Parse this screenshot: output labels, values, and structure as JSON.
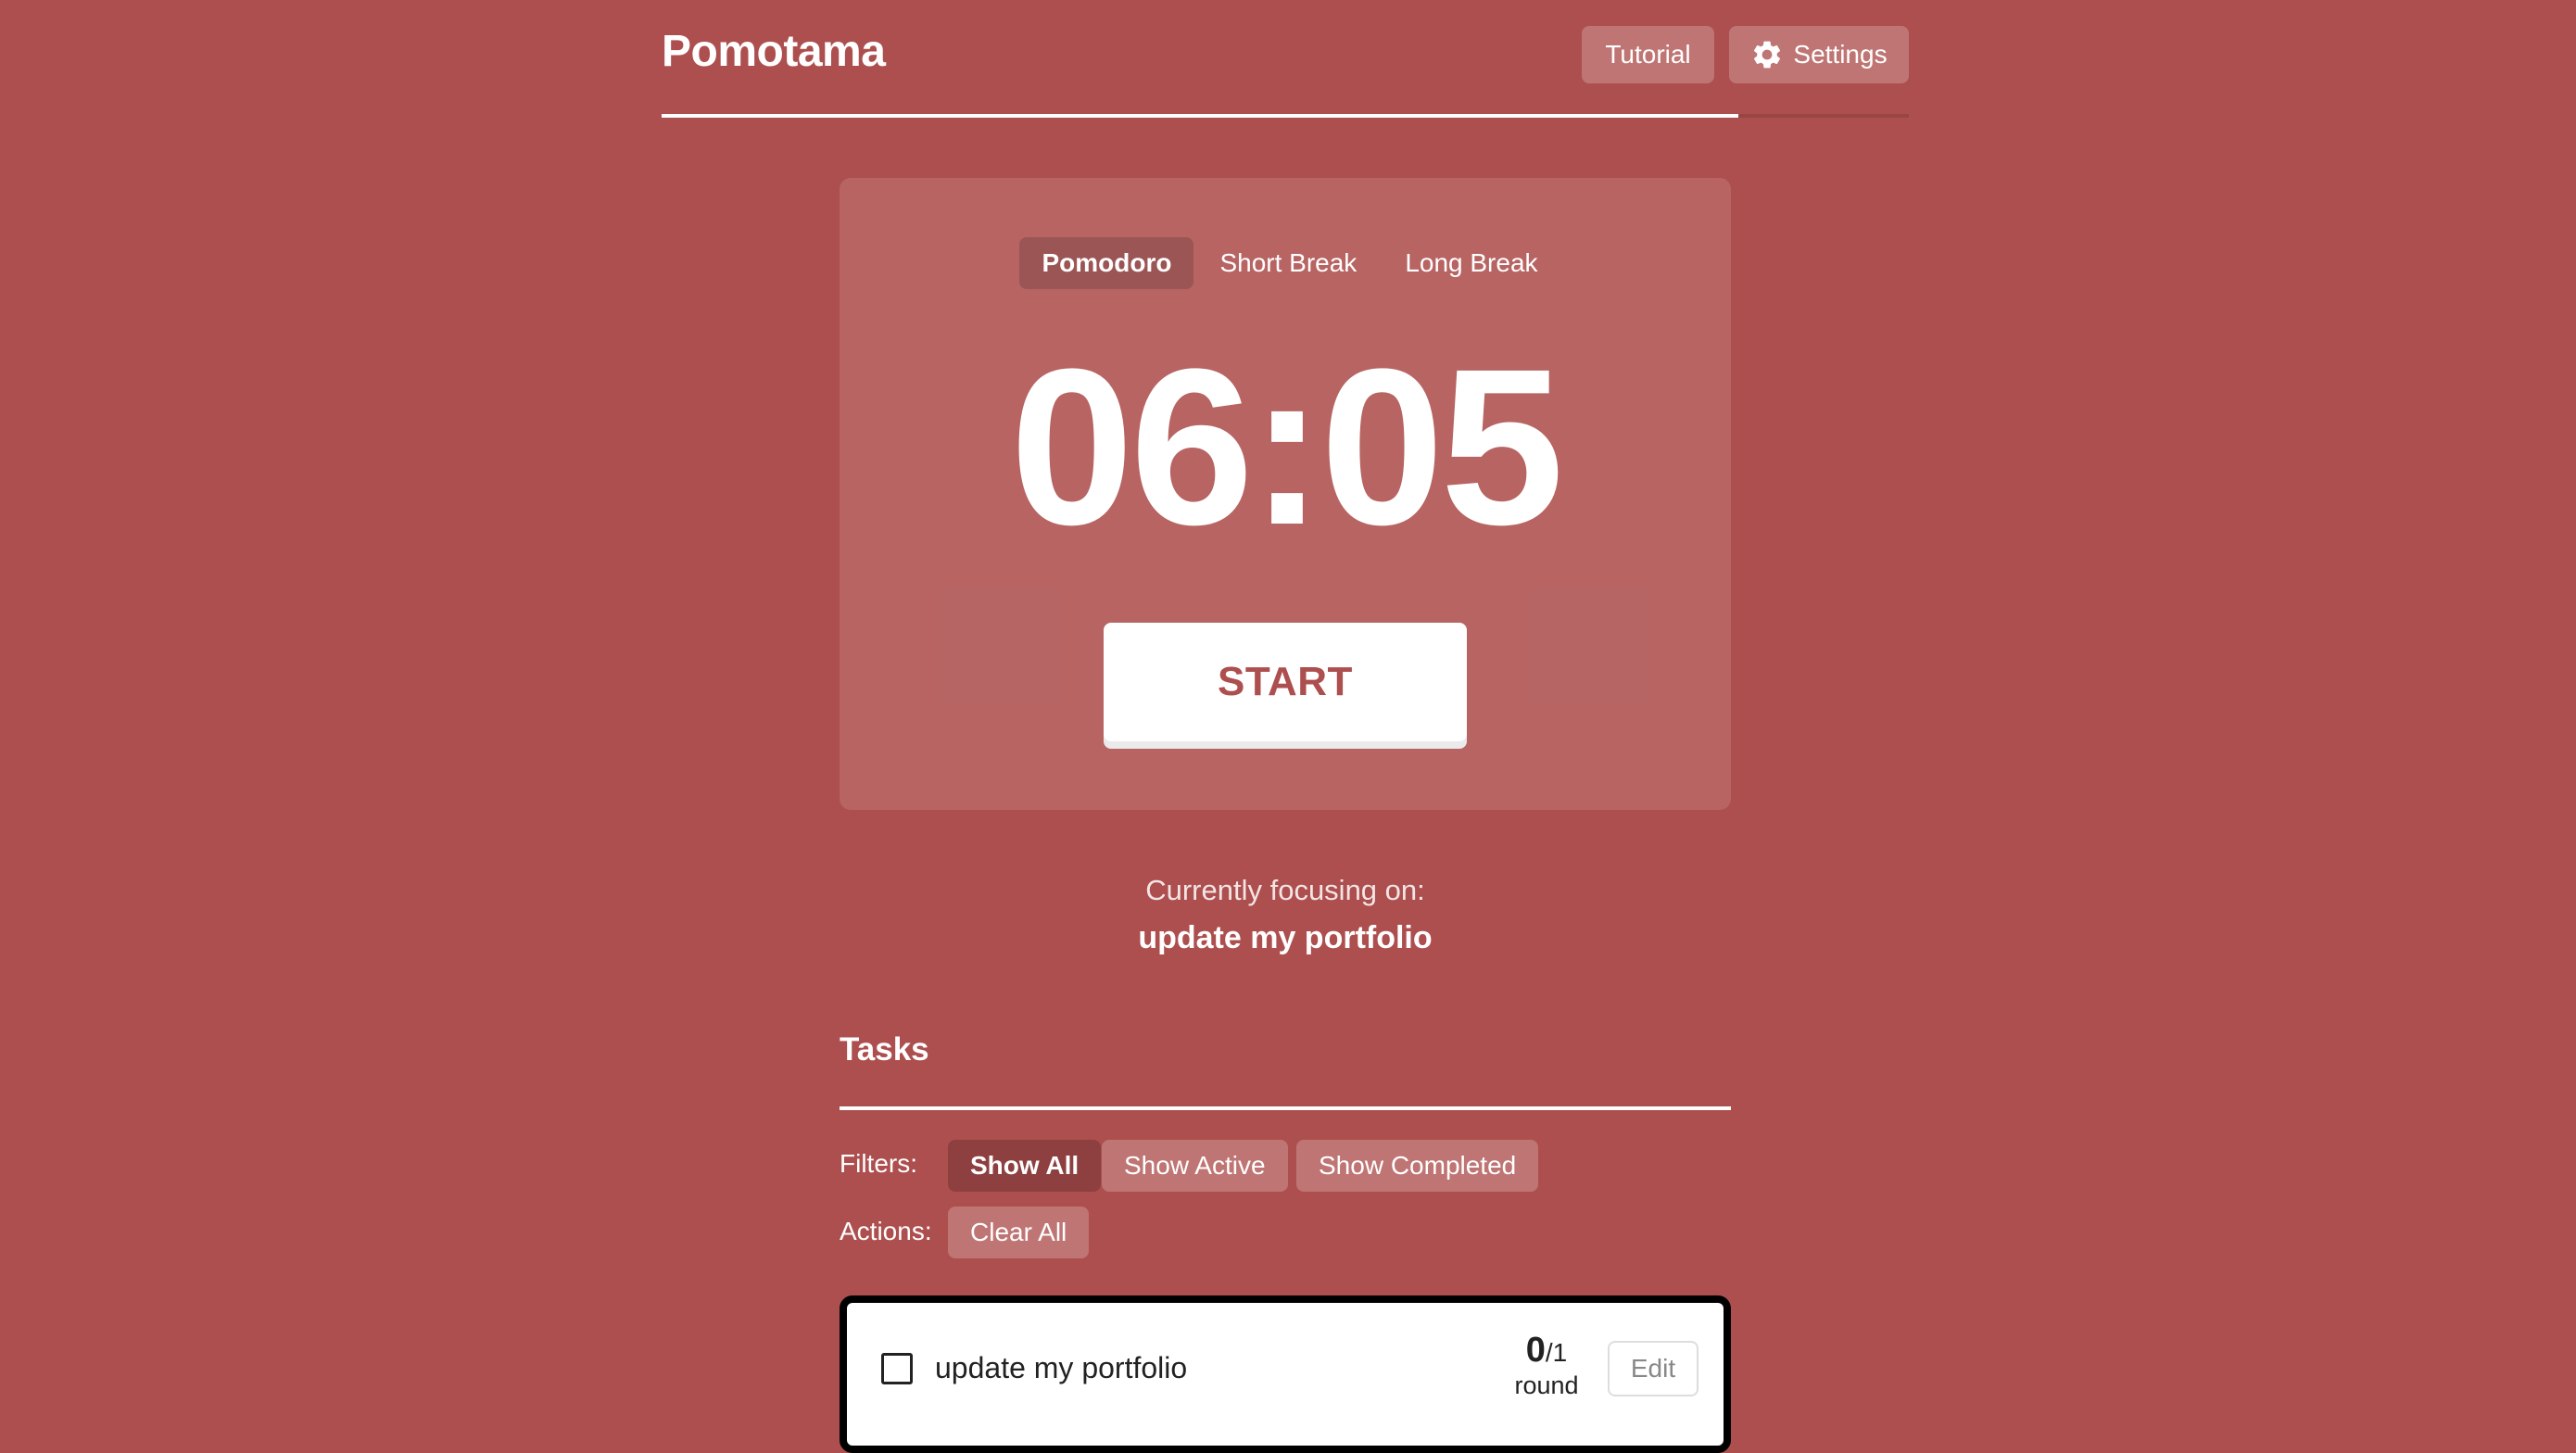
{
  "colors": {
    "background": "#ad4f4e",
    "accent": "#ffffff",
    "start_text": "#ad4f4e",
    "task_card_border": "#000000"
  },
  "header": {
    "title": "Pomotama",
    "tutorial_label": "Tutorial",
    "settings_label": "Settings",
    "settings_icon": "gear-icon"
  },
  "timer": {
    "tabs": [
      {
        "label": "Pomodoro",
        "active": true
      },
      {
        "label": "Short Break",
        "active": false
      },
      {
        "label": "Long Break",
        "active": false
      }
    ],
    "time": "06:05",
    "start_label": "START"
  },
  "focus": {
    "label": "Currently focusing on:",
    "task": "update my portfolio"
  },
  "tasks": {
    "title": "Tasks",
    "filters_label": "Filters:",
    "filters": [
      {
        "label": "Show All",
        "active": true
      },
      {
        "label": "Show Active",
        "active": false
      },
      {
        "label": "Show Completed",
        "active": false
      }
    ],
    "actions_label": "Actions:",
    "actions": [
      {
        "label": "Clear All"
      }
    ],
    "items": [
      {
        "name": "update my portfolio",
        "completed": false,
        "rounds_done": "0",
        "rounds_total": "/1",
        "rounds_unit": "round",
        "edit_label": "Edit"
      }
    ]
  }
}
